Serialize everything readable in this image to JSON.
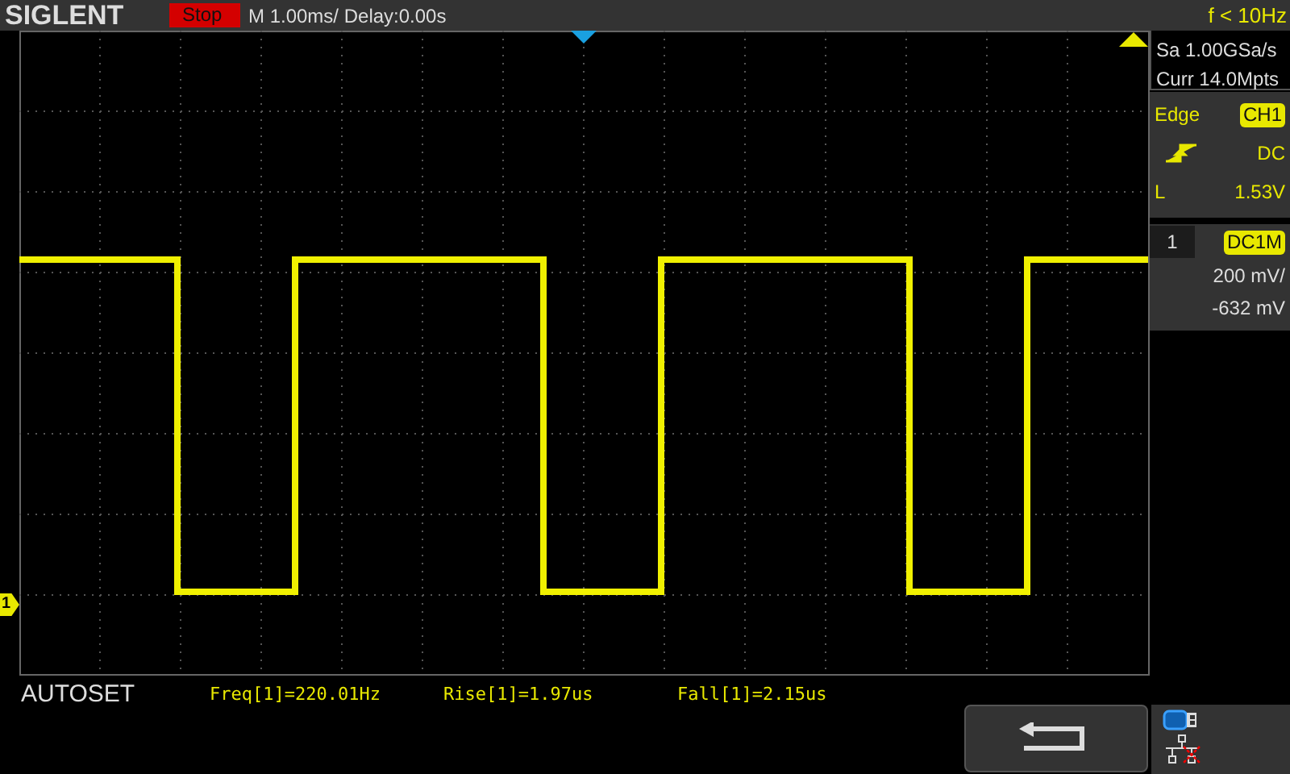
{
  "header": {
    "brand": "SIGLENT",
    "run_state": "Stop",
    "timebase": "M 1.00ms/ Delay:0.00s",
    "frequency": "f < 10Hz"
  },
  "acquisition": {
    "sample_rate": "Sa 1.00GSa/s",
    "memory": "Curr 14.0Mpts"
  },
  "trigger": {
    "type": "Edge",
    "source": "CH1",
    "coupling": "DC",
    "level_label": "L",
    "level_value": "1.53V"
  },
  "channel": {
    "number": "1",
    "coupling": "DC1M",
    "scale": "200 mV/",
    "offset": "-632 mV"
  },
  "channel_marker": "1",
  "autoset": "AUTOSET",
  "measurements": [
    "Freq[1]=220.01Hz",
    "Rise[1]=1.97us",
    "Fall[1]=2.15us"
  ]
}
